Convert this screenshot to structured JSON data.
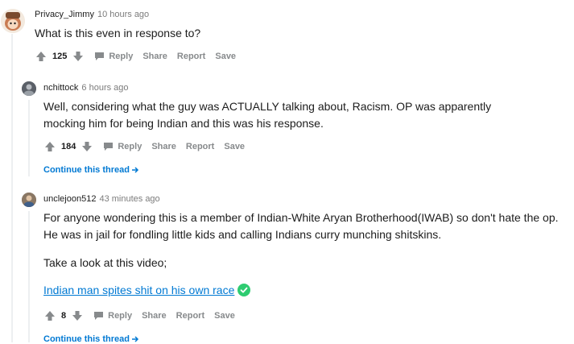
{
  "comments": [
    {
      "author": "Privacy_Jimmy",
      "time": "10 hours ago",
      "body": "What is this even in response to?",
      "score": "125",
      "actions": [
        "Reply",
        "Share",
        "Report",
        "Save"
      ]
    },
    {
      "author": "nchittock",
      "time": "6 hours ago",
      "body": "Well, considering what the guy was ACTUALLY talking about, Racism. OP was apparently mocking him for being Indian and this was his response.",
      "score": "184",
      "actions": [
        "Reply",
        "Share",
        "Report",
        "Save"
      ],
      "continue_label": "Continue this thread"
    },
    {
      "author": "unclejoon512",
      "time": "43 minutes ago",
      "body": "For anyone wondering this is a member of Indian-White Aryan Brotherhood(IWAB) so don't hate the op. He was in jail for fondling little kids and calling Indians curry munching shitskins.",
      "body2": "Take a look at this video;",
      "link_text": "Indian man spites shit on his own race",
      "score": "8",
      "actions": [
        "Reply",
        "Share",
        "Report",
        "Save"
      ],
      "continue_label": "Continue this thread"
    }
  ],
  "icons": {
    "upvote": "arrow-up-icon",
    "downvote": "arrow-down-icon",
    "reply": "speech-bubble-icon",
    "continue": "arrow-right-icon",
    "verified": "check-circle-icon"
  },
  "colors": {
    "link": "#0079d3",
    "meta_gray": "#7c7c7c",
    "action_gray": "#878a8c",
    "verified_green": "#2ecc71"
  }
}
